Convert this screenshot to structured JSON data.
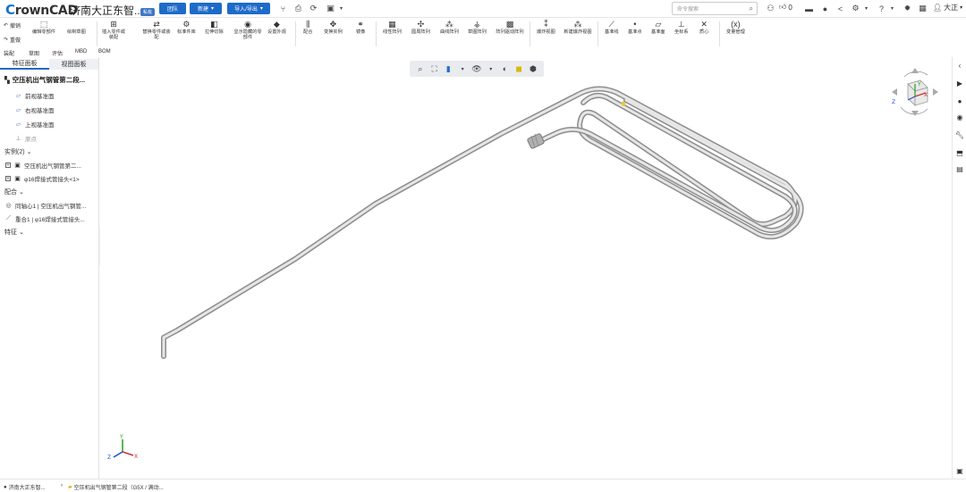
{
  "app": {
    "logo_prefix": "C",
    "logo_rest": "rownCAD",
    "doc_title": "济南大正东智...",
    "doc_badge": "私有"
  },
  "topbar": {
    "team_btn": "团队",
    "new_btn": "新建",
    "import_export_btn": "导入/导出",
    "search_placeholder": "命令搜索",
    "like_count": "0",
    "user_name": "大正"
  },
  "ribbon": {
    "undo": "撤销",
    "redo": "重做",
    "items": [
      "编辑零部件",
      "绘制草图",
      "插入零件或装配",
      "替换零件或装配",
      "标准件库",
      "拉伸切除",
      "显示隐藏的零部件",
      "设置外观",
      "配合",
      "变换实例",
      "镜像",
      "线性阵列",
      "圆周阵列",
      "曲线阵列",
      "草图阵列",
      "阵列驱动阵列",
      "爆炸视图",
      "新建爆炸视图",
      "基准线",
      "基准点",
      "基准面",
      "坐标系",
      "质心",
      "变量管理"
    ]
  },
  "subtabs": [
    "装配",
    "草图",
    "评估",
    "MBD",
    "BOM"
  ],
  "panel": {
    "tabs": [
      "特征面板",
      "视图面板"
    ],
    "root": "空压机出气钢管第二段...",
    "planes": [
      "前视基准面",
      "右视基准面",
      "上视基准面"
    ],
    "origin": "原点",
    "instances_group": "实例(2)",
    "instances": [
      "空压机出气钢管第二...",
      "φ16焊接式管接头<1>"
    ],
    "mates_group": "配合",
    "mates": [
      "同轴心1 | 空压机出气钢管...",
      "重合1 | φ16焊接式管接头..."
    ],
    "features_group": "特征"
  },
  "triad": {
    "x": "X",
    "y": "Y",
    "z": "Z"
  },
  "cube": {
    "x": "X",
    "y": "Y",
    "z": "Z"
  },
  "status": {
    "workspace": "济南大正东智...",
    "path": "空压机出气钢管第二段（G5X / 满动..."
  }
}
